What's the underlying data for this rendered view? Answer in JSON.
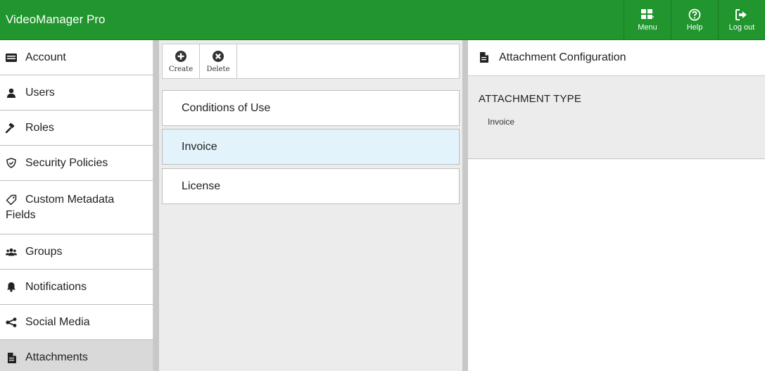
{
  "app": {
    "title": "VideoManager Pro",
    "accent_color": "#21952e"
  },
  "top_actions": [
    {
      "label": "Menu",
      "icon": "grid-menu-icon"
    },
    {
      "label": "Help",
      "icon": "help-circle-icon"
    },
    {
      "label": "Log out",
      "icon": "logout-arrow-icon"
    }
  ],
  "sidebar": {
    "items": [
      {
        "label": "Account",
        "icon": "account-card-icon"
      },
      {
        "label": "Users",
        "icon": "user-icon"
      },
      {
        "label": "Roles",
        "icon": "gavel-icon"
      },
      {
        "label": "Security Policies",
        "icon": "shield-icon"
      },
      {
        "label_line1": "Custom Metadata",
        "label_line2": "Fields",
        "icon": "tag-icon"
      },
      {
        "label": "Groups",
        "icon": "group-icon"
      },
      {
        "label": "Notifications",
        "icon": "bell-icon"
      },
      {
        "label": "Social Media",
        "icon": "share-icon"
      },
      {
        "label": "Attachments",
        "icon": "document-icon",
        "active": true
      }
    ]
  },
  "toolbar": {
    "create_label": "Create",
    "delete_label": "Delete"
  },
  "attachment_list": {
    "items": [
      {
        "label": "Conditions of Use"
      },
      {
        "label": "Invoice",
        "selected": true
      },
      {
        "label": "License"
      }
    ]
  },
  "detail": {
    "header_title": "Attachment Configuration",
    "attachment_type_label": "ATTACHMENT TYPE",
    "attachment_type_value": "Invoice"
  }
}
